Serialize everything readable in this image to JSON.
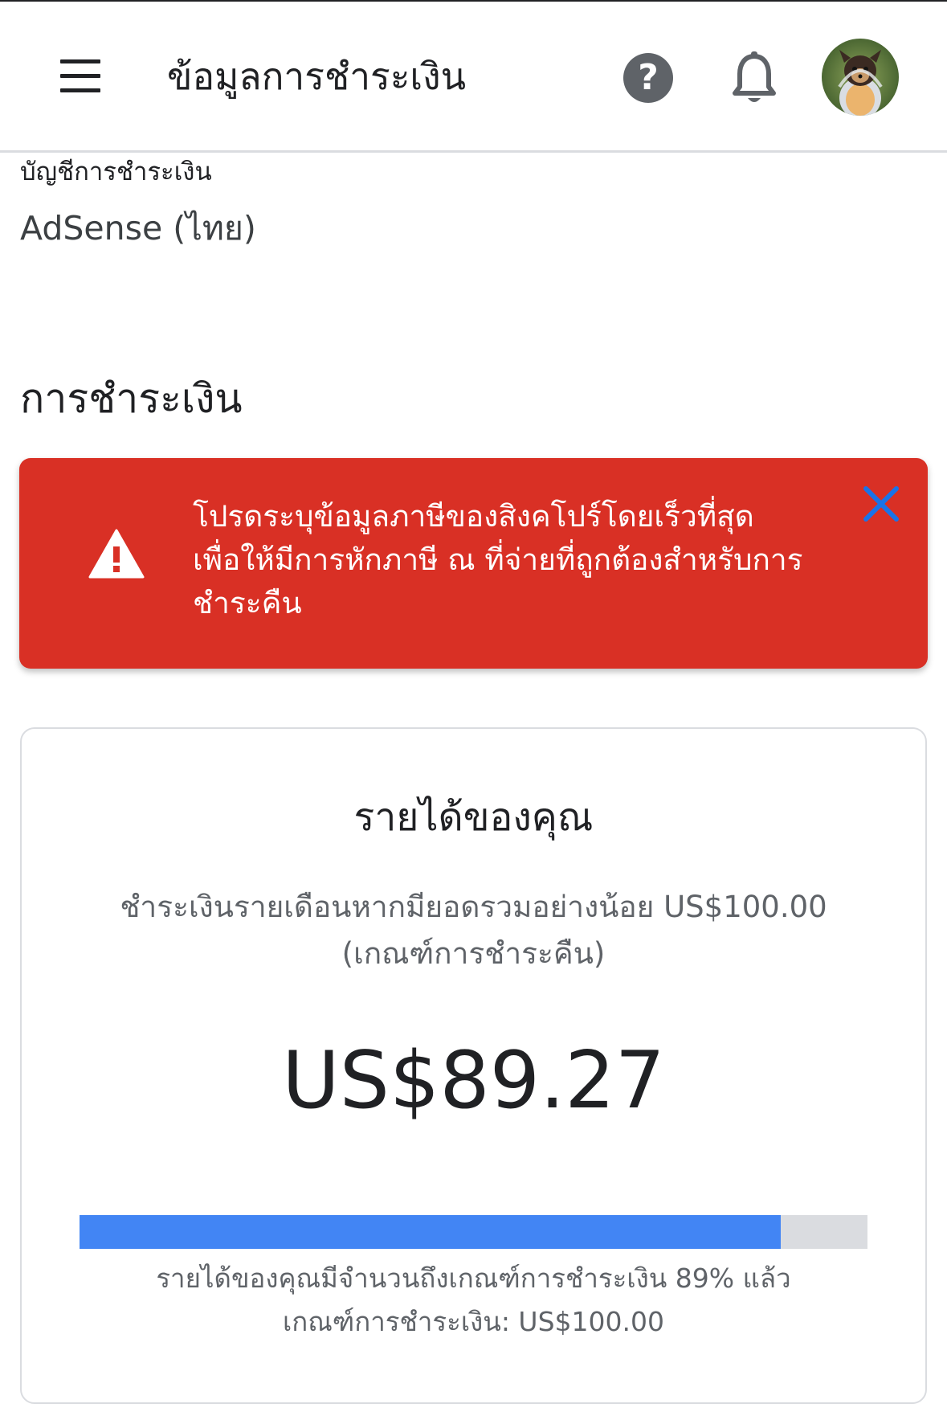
{
  "header": {
    "title": "ข้อมูลการชำระเงิน",
    "menu_icon": "hamburger-menu-icon",
    "help_icon": "help-icon",
    "notifications_icon": "bell-icon"
  },
  "account": {
    "label": "บัญชีการชำระเงิน",
    "name": "AdSense (ไทย)"
  },
  "payments": {
    "section_title": "การชำระเงิน"
  },
  "alert": {
    "message": "โปรดระบุข้อมูลภาษีของสิงคโปร์โดยเร็วที่สุด เพื่อให้มีการหักภาษี ณ ที่จ่ายที่ถูกต้องสำหรับการชำระคืน",
    "warning_icon": "warning-icon",
    "close_icon": "close-icon"
  },
  "earnings": {
    "title": "รายได้ของคุณ",
    "description_line1": "ชำระเงินรายเดือนหากมียอดรวมอย่างน้อย US$100.00",
    "description_line2": "(เกณฑ์การชำระคืน)",
    "amount": "US$89.27",
    "progress_percent": 89,
    "progress_text": "รายได้ของคุณมีจำนวนถึงเกณฑ์การชำระเงิน 89% แล้ว",
    "threshold_text": "เกณฑ์การชำระเงิน: US$100.00"
  },
  "colors": {
    "alert_bg": "#d93025",
    "progress_fill": "#4285f4",
    "progress_track": "#dadce0",
    "close_icon": "#1a73e8"
  }
}
